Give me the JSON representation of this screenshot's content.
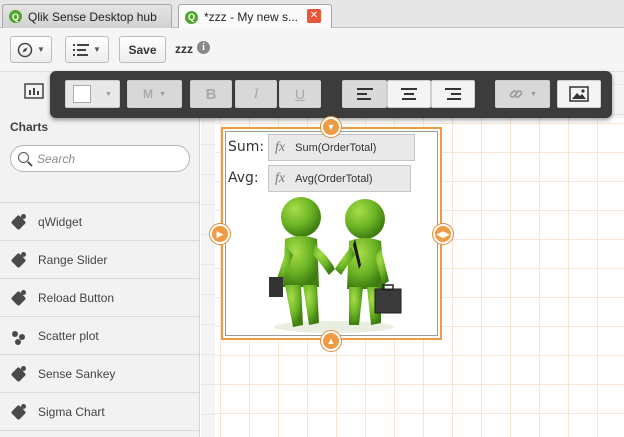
{
  "browser": {
    "tabs": [
      {
        "title": "Qlik Sense Desktop hub",
        "active": false
      },
      {
        "title": "*zzz - My new s...",
        "active": true
      }
    ]
  },
  "toolbar": {
    "save_label": "Save",
    "app_name": "zzz",
    "info_glyph": "i"
  },
  "format_toolbar": {
    "size_label": "M",
    "bold_label": "B",
    "italic_label": "I",
    "underline_label": "U",
    "text_color": "#ffffff"
  },
  "sidebar": {
    "heading": "Charts",
    "search_placeholder": "Search",
    "items": [
      {
        "label": "qWidget",
        "icon": "puzzle-icon"
      },
      {
        "label": "Range Slider",
        "icon": "puzzle-icon"
      },
      {
        "label": "Reload Button",
        "icon": "puzzle-icon"
      },
      {
        "label": "Scatter plot",
        "icon": "scatter-icon"
      },
      {
        "label": "Sense Sankey",
        "icon": "puzzle-icon"
      },
      {
        "label": "Sigma Chart",
        "icon": "puzzle-icon"
      }
    ]
  },
  "text_object": {
    "rows": [
      {
        "label": "Sum:",
        "expression": "Sum(OrderTotal)"
      },
      {
        "label": "Avg:",
        "expression": "Avg(OrderTotal)"
      }
    ],
    "fx_symbol": "fx",
    "image": "two-green-figures-shaking-hands"
  },
  "colors": {
    "accent": "#ef9a44",
    "qlik_green": "#52a52e",
    "close_red": "#e65638",
    "figure_green": "#6bb324"
  }
}
